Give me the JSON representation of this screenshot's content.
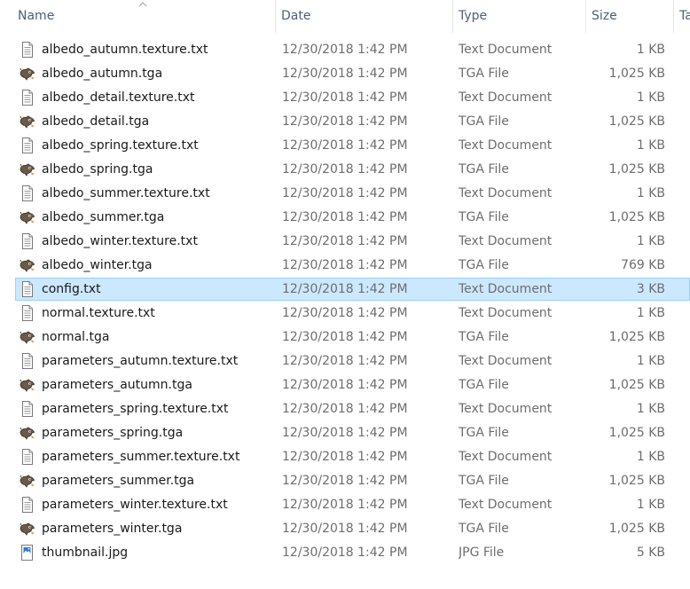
{
  "columns": {
    "name": "Name",
    "date": "Date",
    "type": "Type",
    "size": "Size",
    "tags": "Ta"
  },
  "files": [
    {
      "name": "albedo_autumn.texture.txt",
      "date": "12/30/2018 1:42 PM",
      "type": "Text Document",
      "size": "1 KB",
      "icon": "text-file-icon"
    },
    {
      "name": "albedo_autumn.tga",
      "date": "12/30/2018 1:42 PM",
      "type": "TGA File",
      "size": "1,025 KB",
      "icon": "gimp-file-icon"
    },
    {
      "name": "albedo_detail.texture.txt",
      "date": "12/30/2018 1:42 PM",
      "type": "Text Document",
      "size": "1 KB",
      "icon": "text-file-icon"
    },
    {
      "name": "albedo_detail.tga",
      "date": "12/30/2018 1:42 PM",
      "type": "TGA File",
      "size": "1,025 KB",
      "icon": "gimp-file-icon"
    },
    {
      "name": "albedo_spring.texture.txt",
      "date": "12/30/2018 1:42 PM",
      "type": "Text Document",
      "size": "1 KB",
      "icon": "text-file-icon"
    },
    {
      "name": "albedo_spring.tga",
      "date": "12/30/2018 1:42 PM",
      "type": "TGA File",
      "size": "1,025 KB",
      "icon": "gimp-file-icon"
    },
    {
      "name": "albedo_summer.texture.txt",
      "date": "12/30/2018 1:42 PM",
      "type": "Text Document",
      "size": "1 KB",
      "icon": "text-file-icon"
    },
    {
      "name": "albedo_summer.tga",
      "date": "12/30/2018 1:42 PM",
      "type": "TGA File",
      "size": "1,025 KB",
      "icon": "gimp-file-icon"
    },
    {
      "name": "albedo_winter.texture.txt",
      "date": "12/30/2018 1:42 PM",
      "type": "Text Document",
      "size": "1 KB",
      "icon": "text-file-icon"
    },
    {
      "name": "albedo_winter.tga",
      "date": "12/30/2018 1:42 PM",
      "type": "TGA File",
      "size": "769 KB",
      "icon": "gimp-file-icon"
    },
    {
      "name": "config.txt",
      "date": "12/30/2018 1:42 PM",
      "type": "Text Document",
      "size": "3 KB",
      "icon": "text-file-icon",
      "selected": true
    },
    {
      "name": "normal.texture.txt",
      "date": "12/30/2018 1:42 PM",
      "type": "Text Document",
      "size": "1 KB",
      "icon": "text-file-icon"
    },
    {
      "name": "normal.tga",
      "date": "12/30/2018 1:42 PM",
      "type": "TGA File",
      "size": "1,025 KB",
      "icon": "gimp-file-icon"
    },
    {
      "name": "parameters_autumn.texture.txt",
      "date": "12/30/2018 1:42 PM",
      "type": "Text Document",
      "size": "1 KB",
      "icon": "text-file-icon"
    },
    {
      "name": "parameters_autumn.tga",
      "date": "12/30/2018 1:42 PM",
      "type": "TGA File",
      "size": "1,025 KB",
      "icon": "gimp-file-icon"
    },
    {
      "name": "parameters_spring.texture.txt",
      "date": "12/30/2018 1:42 PM",
      "type": "Text Document",
      "size": "1 KB",
      "icon": "text-file-icon"
    },
    {
      "name": "parameters_spring.tga",
      "date": "12/30/2018 1:42 PM",
      "type": "TGA File",
      "size": "1,025 KB",
      "icon": "gimp-file-icon"
    },
    {
      "name": "parameters_summer.texture.txt",
      "date": "12/30/2018 1:42 PM",
      "type": "Text Document",
      "size": "1 KB",
      "icon": "text-file-icon"
    },
    {
      "name": "parameters_summer.tga",
      "date": "12/30/2018 1:42 PM",
      "type": "TGA File",
      "size": "1,025 KB",
      "icon": "gimp-file-icon"
    },
    {
      "name": "parameters_winter.texture.txt",
      "date": "12/30/2018 1:42 PM",
      "type": "Text Document",
      "size": "1 KB",
      "icon": "text-file-icon"
    },
    {
      "name": "parameters_winter.tga",
      "date": "12/30/2018 1:42 PM",
      "type": "TGA File",
      "size": "1,025 KB",
      "icon": "gimp-file-icon"
    },
    {
      "name": "thumbnail.jpg",
      "date": "12/30/2018 1:42 PM",
      "type": "JPG File",
      "size": "5 KB",
      "icon": "image-file-icon"
    }
  ],
  "colors": {
    "header_text": "#4c607a",
    "selection_fill": "#cce8ff",
    "selection_border": "#99d1ff",
    "secondary_text": "#6d6d6d"
  }
}
